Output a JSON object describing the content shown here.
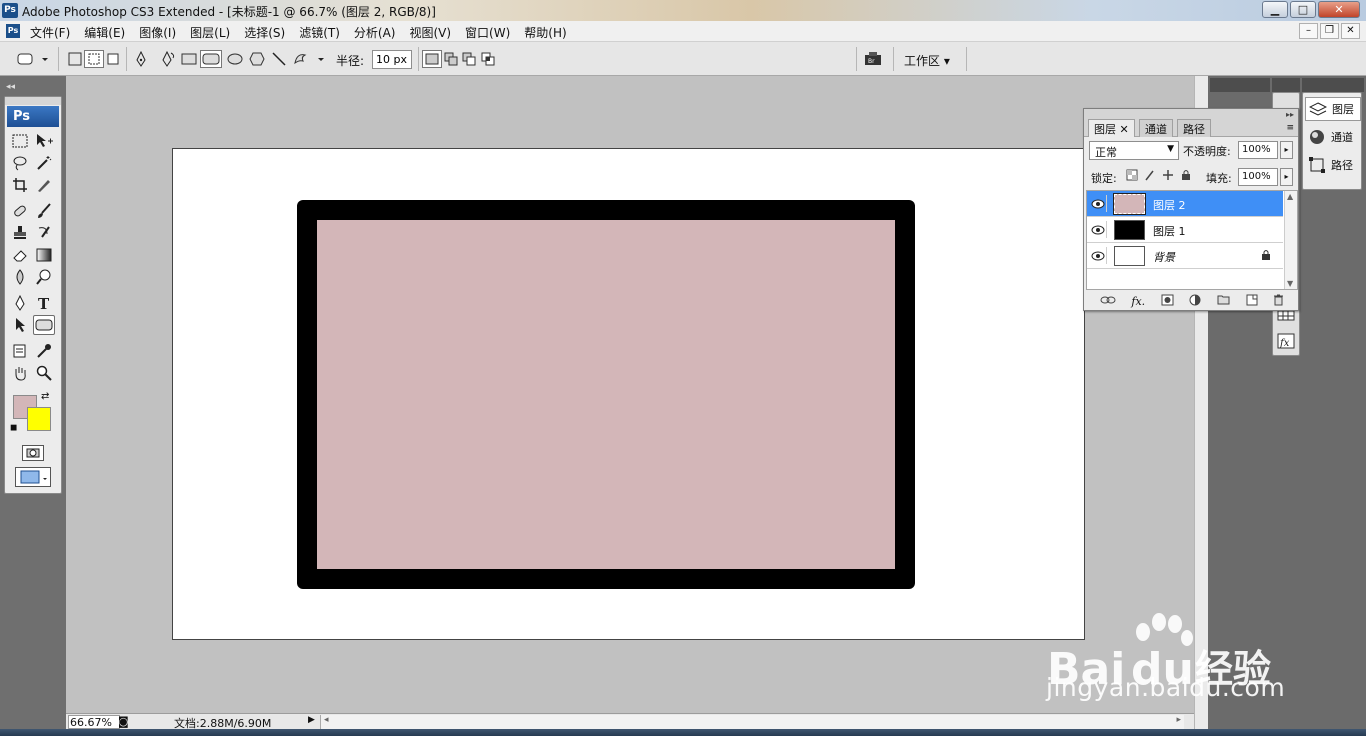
{
  "window": {
    "title": "Adobe Photoshop CS3 Extended - [未标题-1 @ 66.7% (图层 2, RGB/8)]",
    "app_icon": "Ps",
    "controls": [
      "minimize",
      "maximize",
      "close"
    ]
  },
  "menubar": {
    "items": [
      "文件(F)",
      "编辑(E)",
      "图像(I)",
      "图层(L)",
      "选择(S)",
      "滤镜(T)",
      "分析(A)",
      "视图(V)",
      "窗口(W)",
      "帮助(H)"
    ]
  },
  "options_bar": {
    "radius_label": "半径:",
    "radius_value": "10 px",
    "workspace_label": "工作区"
  },
  "toolbox": {
    "logo": "Ps",
    "foreground_color": "#d3b6b8",
    "background_color": "#ffff00"
  },
  "canvas": {
    "page_color": "#ffffff",
    "rect_stroke_color": "#000000",
    "rect_fill_color": "#d3b6b8"
  },
  "status": {
    "zoom": "66.67%",
    "doc_info": "文档:2.88M/6.90M"
  },
  "layers_panel": {
    "tabs": [
      "图层",
      "通道",
      "路径"
    ],
    "blend_mode": "正常",
    "opacity_label": "不透明度:",
    "opacity_value": "100%",
    "lock_label": "锁定:",
    "fill_label": "填充:",
    "fill_value": "100%",
    "layers": [
      {
        "name": "图层 2",
        "selected": true,
        "thumb": "#d3b6b8"
      },
      {
        "name": "图层 1",
        "selected": false,
        "thumb": "#000000"
      },
      {
        "name": "背景",
        "selected": false,
        "thumb": "#ffffff",
        "locked": true
      }
    ]
  },
  "dock_tabs": [
    "图层",
    "通道",
    "路径"
  ],
  "watermark": {
    "brand": "Bai du 经验",
    "url": "jingyan.baidu.com"
  }
}
